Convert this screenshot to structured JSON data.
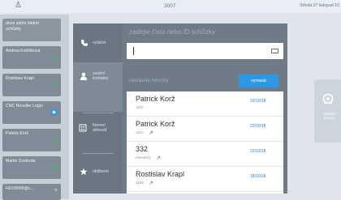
{
  "topbar": {
    "center_text": "3007",
    "datetime": "Středa 07 listopad   10"
  },
  "left_strip": {
    "items": [
      {
        "label": "dnes zatím žádné schůzky"
      },
      {
        "label": "Andrea Kotěšková"
      },
      {
        "label": "Rostislav Krapl"
      },
      {
        "label": "CNC Reseller Login"
      },
      {
        "label": "Patrick Korž"
      },
      {
        "label": "Martin Svoboda"
      },
      {
        "label": "HDX8000@c..."
      }
    ]
  },
  "nav": {
    "dial": "vytáčet",
    "contacts": "osobní kontakty",
    "directory": "firemní adresář",
    "favorites": "oblíbené"
  },
  "dial": {
    "prompt": "zadejte číslo nebo ID schůzky",
    "input_value": ""
  },
  "recent": {
    "title": "nedávné hovory",
    "clear_label": "vymazat",
    "rows": [
      {
        "name": "Patrick Korž",
        "sub": "1110",
        "date": "23/10/18"
      },
      {
        "name": "Patrick Korž",
        "sub": "1110",
        "date": "23/10/18"
      },
      {
        "name": "332",
        "sub": "neznámý",
        "date": "22/10/18"
      },
      {
        "name": "Rostislav Krapl",
        "sub": "1105",
        "date": "18/10/18"
      }
    ]
  },
  "right_panel": {
    "label": "ovládání kamery"
  },
  "colors": {
    "accent": "#2d98e6",
    "date_text": "#2d7fc2",
    "panel": "#6f7b87"
  }
}
